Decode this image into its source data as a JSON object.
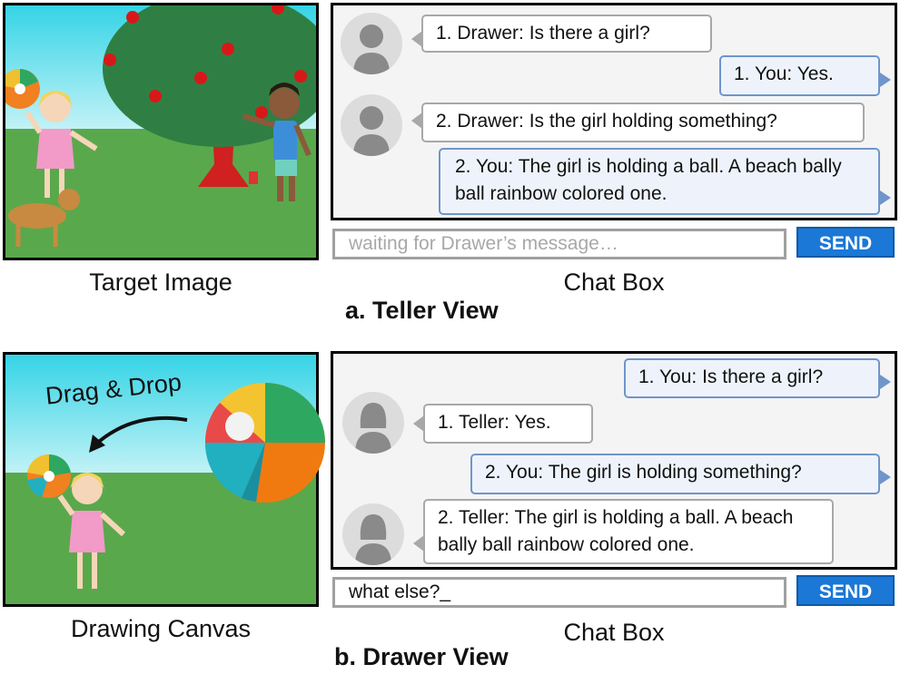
{
  "teller": {
    "image_caption": "Target Image",
    "chat_caption": "Chat Box",
    "view_title": "a. Teller View",
    "messages": [
      {
        "text": "1. Drawer:  Is there a girl?"
      },
      {
        "text": "1. You:  Yes."
      },
      {
        "text": "2. Drawer:  Is the girl holding something?"
      },
      {
        "text": "2. You:  The girl is holding a ball. A beach bally ball rainbow colored one."
      }
    ],
    "input_placeholder": "waiting for Drawer’s message…",
    "send_label": "SEND"
  },
  "drawer": {
    "image_caption": "Drawing Canvas",
    "chat_caption": "Chat Box",
    "view_title": "b. Drawer View",
    "drag_label": "Drag & Drop",
    "messages": [
      {
        "text": "1. You:  Is there a girl?"
      },
      {
        "text": "1. Teller:  Yes."
      },
      {
        "text": "2. You:  The girl is holding something?"
      },
      {
        "text": "2. Teller:  The girl is holding a ball. A beach bally ball rainbow colored one."
      }
    ],
    "input_value": "what else?_",
    "send_label": "SEND"
  },
  "colors": {
    "sky": "#3fd9e6",
    "grass": "#5aa84c",
    "send_button": "#1b78d6",
    "user_bubble_border": "#6f95cc",
    "other_bubble_border": "#a8a8a8"
  }
}
